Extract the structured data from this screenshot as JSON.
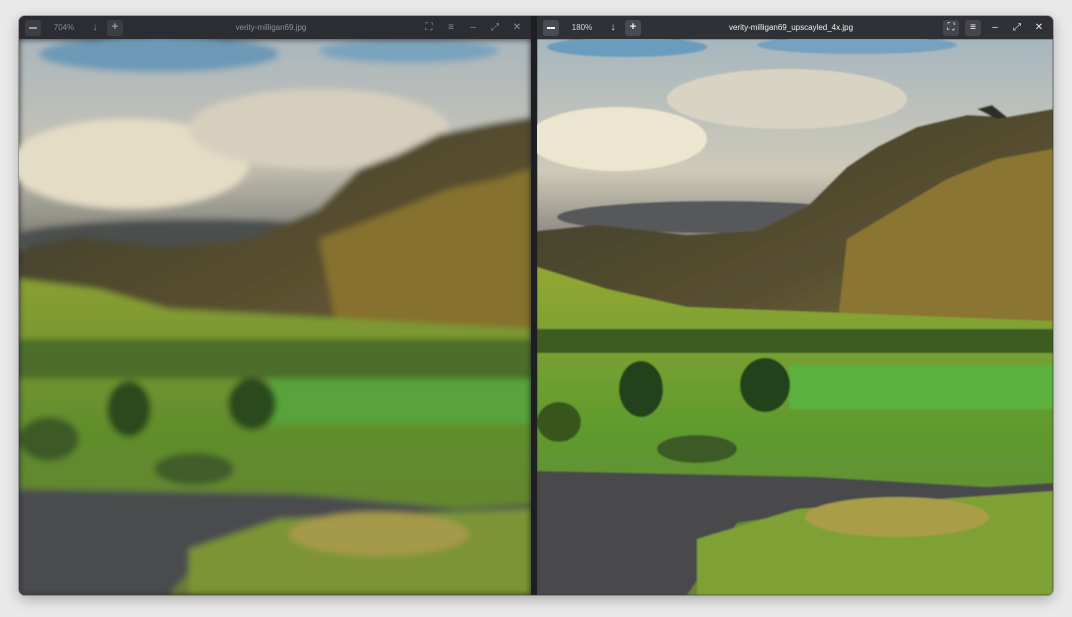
{
  "left_window": {
    "zoom": "704%",
    "title": "verity-milligan69.jpg"
  },
  "right_window": {
    "zoom": "180%",
    "title": "verity-milligan69_upscayled_4x.jpg"
  },
  "icons": {
    "zoom_out": "minus-icon",
    "download": "arrow-down-icon",
    "zoom_in": "plus-icon",
    "fullscreen": "fullscreen-icon",
    "menu": "hamburger-menu-icon",
    "minimize": "minimize-icon",
    "maximize": "maximize-icon",
    "close": "close-icon"
  },
  "glyphs": {
    "arrow_down": "↓",
    "fullscreen": "⛶",
    "menu": "≡",
    "minimize": "–",
    "maximize": "⤢",
    "close": "✕"
  },
  "colors": {
    "sky": "#b9c0c5",
    "cloud": "#e6e0cf",
    "blue_sky": "#6f9fbe",
    "mountain_dark": "#3f3f2c",
    "mountain_lit": "#7a6b3a",
    "meadow": "#6f9a2c",
    "field": "#4f8a28",
    "road": "#4b4d4f"
  }
}
